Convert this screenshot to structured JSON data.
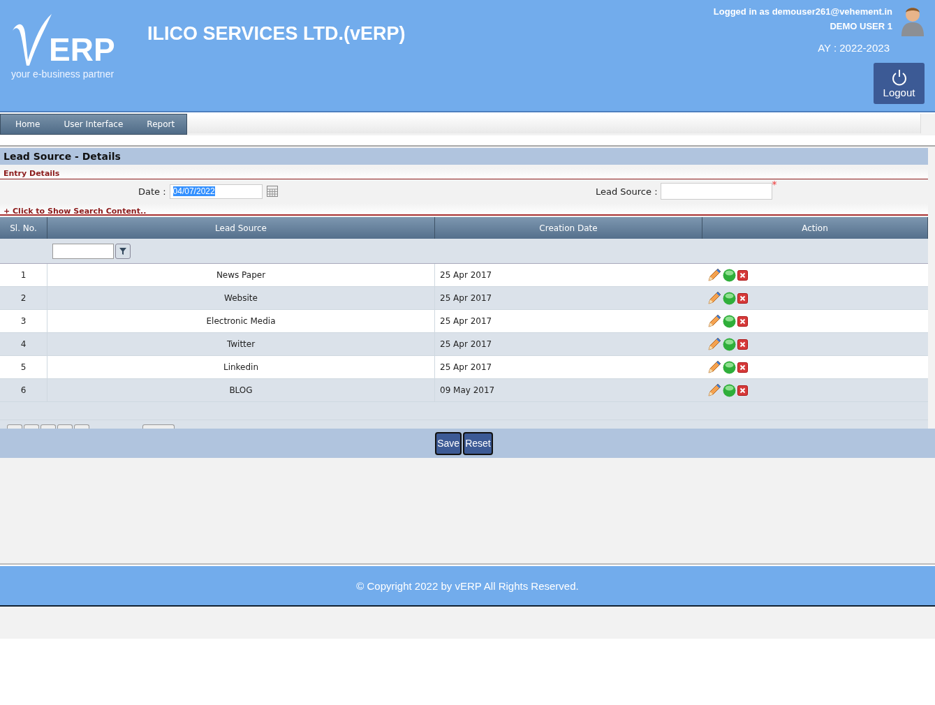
{
  "header": {
    "tagline": "your e-business partner",
    "logo_text": "ERP",
    "company": "ILICO SERVICES LTD.(vERP)",
    "logged_in": "Logged in as demouser261@vehement.in",
    "user": "DEMO USER 1",
    "year": "AY : 2022-2023",
    "logout": "Logout"
  },
  "menu": [
    {
      "label": "Home"
    },
    {
      "label": "User Interface"
    },
    {
      "label": "Report"
    }
  ],
  "page_title": "Lead Source - Details",
  "entry_title": "Entry Details",
  "form": {
    "date_label": "Date :",
    "date_value": "04/07/2022",
    "source_label": "Lead Source :",
    "required_mark": "*"
  },
  "search_toggle": "+ Click to Show Search Content..",
  "table": {
    "columns": [
      "Sl. No.",
      "Lead Source",
      "Creation Date",
      "Action"
    ],
    "rows": [
      {
        "no": "1",
        "source": "News Paper",
        "date": "25 Apr 2017"
      },
      {
        "no": "2",
        "source": "Website",
        "date": "25 Apr 2017"
      },
      {
        "no": "3",
        "source": "Electronic Media",
        "date": "25 Apr 2017"
      },
      {
        "no": "4",
        "source": "Twitter",
        "date": "25 Apr 2017"
      },
      {
        "no": "5",
        "source": "Linkedin",
        "date": "25 Apr 2017"
      },
      {
        "no": "6",
        "source": "BLOG",
        "date": "09 May 2017"
      }
    ]
  },
  "buttons": [
    "Save",
    "Reset"
  ],
  "footer": "© Copyright 2022 by vERP All Rights Reserved."
}
